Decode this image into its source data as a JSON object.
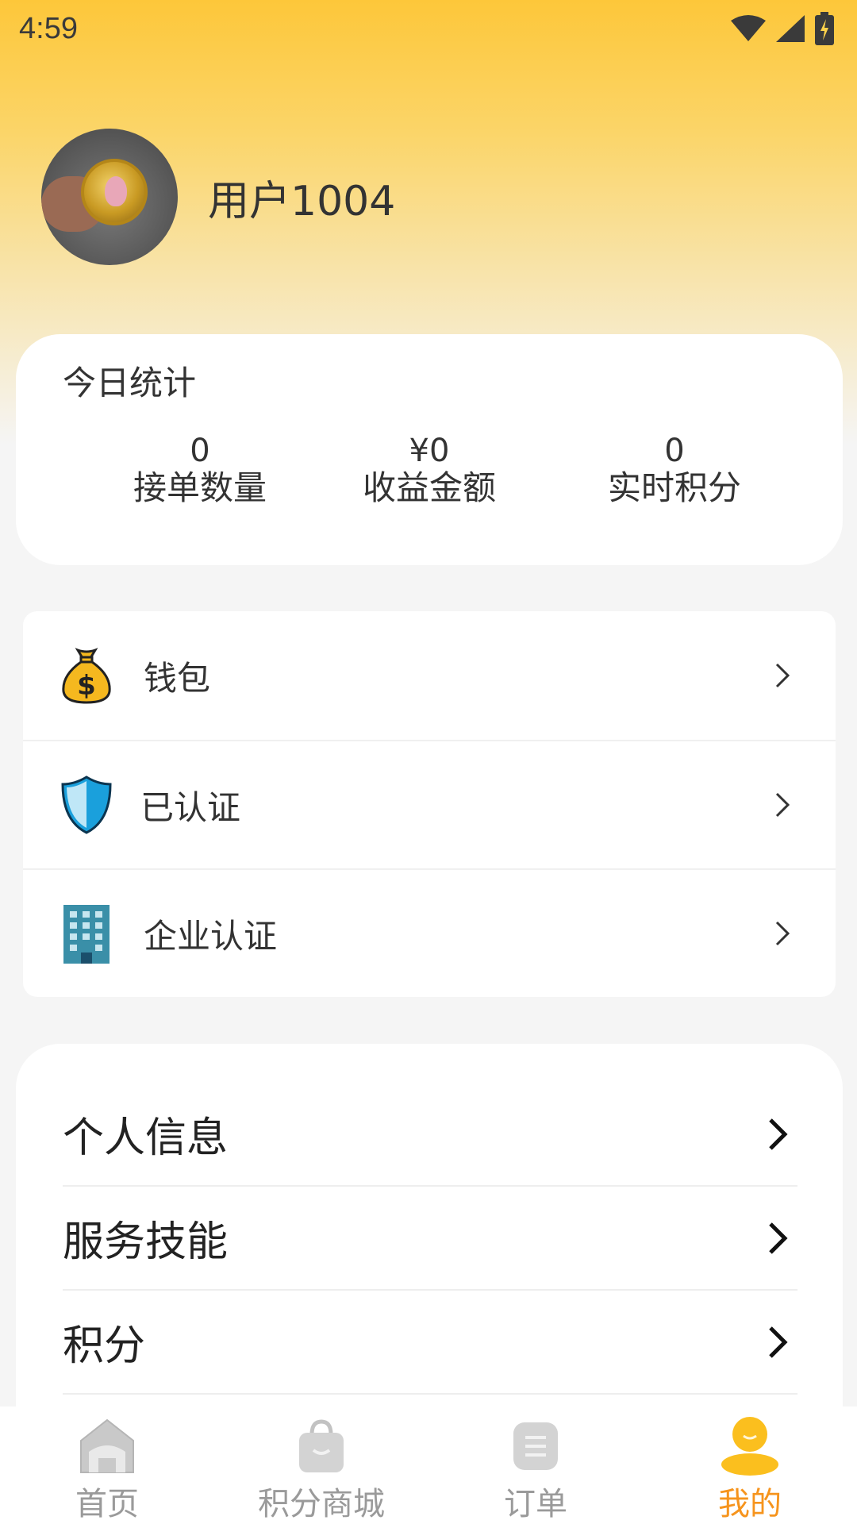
{
  "status_bar": {
    "time": "4:59"
  },
  "profile": {
    "username": "用户1004"
  },
  "stats": {
    "title": "今日统计",
    "items": [
      {
        "value": "0",
        "label": "接单数量"
      },
      {
        "value": "¥0",
        "label": "收益金额"
      },
      {
        "value": "0",
        "label": "实时积分"
      }
    ]
  },
  "menu": {
    "items": [
      {
        "label": "钱包",
        "icon": "money-bag-icon"
      },
      {
        "label": "已认证",
        "icon": "shield-icon"
      },
      {
        "label": "企业认证",
        "icon": "building-icon"
      }
    ]
  },
  "list": {
    "items": [
      {
        "label": "个人信息"
      },
      {
        "label": "服务技能"
      },
      {
        "label": "积分"
      }
    ]
  },
  "tabbar": {
    "items": [
      {
        "label": "首页",
        "icon": "home-icon"
      },
      {
        "label": "积分商城",
        "icon": "shopping-bag-icon"
      },
      {
        "label": "订单",
        "icon": "order-icon"
      },
      {
        "label": "我的",
        "icon": "user-icon"
      }
    ],
    "active_index": 3
  },
  "colors": {
    "accent": "#f6941d",
    "header": "#fdc73a"
  }
}
